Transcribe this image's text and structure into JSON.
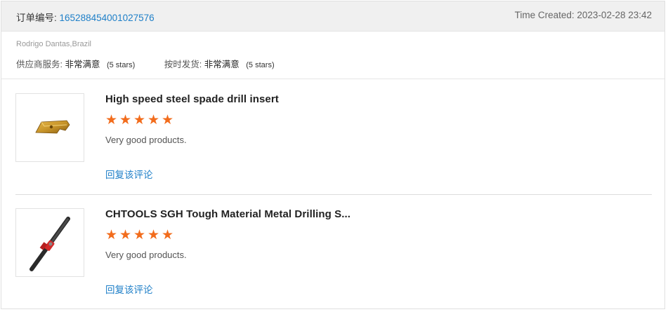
{
  "order": {
    "label": "订单编号:",
    "number": "165288454001027576",
    "time_label": "Time Created:",
    "time_value": "2023-02-28 23:42"
  },
  "buyer": {
    "name": "Rodrigo Dantas,Brazil"
  },
  "ratings": [
    {
      "label": "供应商服务:",
      "value": "非常满意",
      "stars": "(5 stars)"
    },
    {
      "label": "按时发货:",
      "value": "非常满意",
      "stars": "(5 stars)"
    }
  ],
  "items": [
    {
      "title": "High speed steel spade drill insert",
      "star_count": 5,
      "review": "Very good products.",
      "reply_label": "回复该评论"
    },
    {
      "title": "CHTOOLS SGH Tough Material Metal Drilling S...",
      "star_count": 5,
      "review": "Very good products.",
      "reply_label": "回复该评论"
    }
  ],
  "colors": {
    "accent": "#1e7fc8",
    "star": "#f26c1c",
    "header_bg": "#f0f0f0"
  }
}
